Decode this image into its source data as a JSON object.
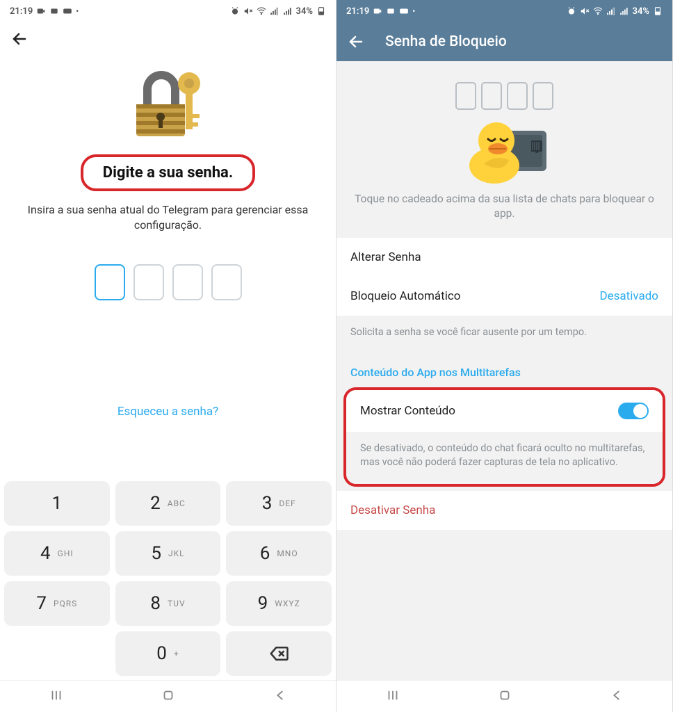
{
  "status": {
    "time": "21:19",
    "battery": "34%"
  },
  "phone1": {
    "title": "Digite a sua senha.",
    "subtitle": "Insira a sua senha atual do Telegram para gerenciar essa configuração.",
    "forgot": "Esqueceu a senha?",
    "keypad": [
      {
        "num": "1",
        "letters": ""
      },
      {
        "num": "2",
        "letters": "ABC"
      },
      {
        "num": "3",
        "letters": "DEF"
      },
      {
        "num": "4",
        "letters": "GHI"
      },
      {
        "num": "5",
        "letters": "JKL"
      },
      {
        "num": "6",
        "letters": "MNO"
      },
      {
        "num": "7",
        "letters": "PQRS"
      },
      {
        "num": "8",
        "letters": "TUV"
      },
      {
        "num": "9",
        "letters": "WXYZ"
      },
      {
        "num": "",
        "letters": ""
      },
      {
        "num": "0",
        "letters": "+"
      },
      {
        "num": "BK",
        "letters": ""
      }
    ]
  },
  "phone2": {
    "header": "Senha de Bloqueio",
    "heroHint": "Toque no cadeado acima da sua lista de chats para bloquear o app.",
    "items": {
      "changePass": "Alterar Senha",
      "autoLock": "Bloqueio Automático",
      "autoLockValue": "Desativado",
      "autoLockDesc": "Solicita a senha se você ficar ausente por um tempo.",
      "sectionHeader": "Conteúdo do App nos Multitarefas",
      "showContent": "Mostrar Conteúdo",
      "showContentDesc": "Se desativado, o conteúdo do chat ficará oculto no multitarefas, mas você não poderá fazer capturas de tela no aplicativo.",
      "disablePass": "Desativar Senha"
    }
  }
}
